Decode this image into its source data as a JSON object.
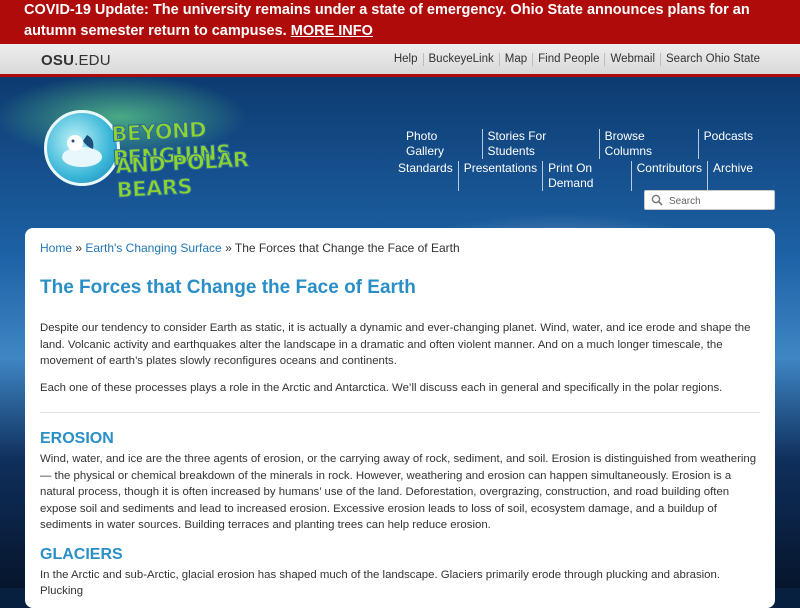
{
  "banner": {
    "text": "COVID-19 Update: The university remains under a state of emergency. Ohio State announces plans for an autumn semester return to campuses.",
    "link": "MORE INFO",
    "color": "#b00b0b"
  },
  "osu_bar": {
    "brand_bold": "OSU",
    "brand_rest": ".EDU",
    "links": [
      "Help",
      "BuckeyeLink",
      "Map",
      "Find People",
      "Webmail",
      "Search Ohio State"
    ]
  },
  "logo": {
    "line1": "BEYOND PENGUINS",
    "line2": "AND POLAR BEARS"
  },
  "nav": {
    "row1": [
      "Photo Gallery",
      "Stories For Students",
      "Browse Columns",
      "Podcasts"
    ],
    "row2": [
      "Standards",
      "Presentations",
      "Print On Demand",
      "Contributors",
      "Archive"
    ]
  },
  "search": {
    "placeholder": "Search",
    "icon": "search-icon"
  },
  "breadcrumb": {
    "home": "Home",
    "sep1": " » ",
    "parent": "Earth's Changing Surface",
    "sep2": " » ",
    "current": "The Forces that Change the Face of Earth"
  },
  "page": {
    "title": "The Forces that Change the Face of Earth",
    "intro1": "Despite our tendency to consider Earth as static, it is actually a dynamic and ever-changing planet. Wind, water, and ice erode and shape the land. Volcanic activity and earthquakes alter the landscape in a dramatic and often violent manner. And on a much longer timescale, the movement of earth’s plates slowly reconfigures oceans and continents.",
    "intro2": "Each one of these processes plays a role in the Arctic and Antarctica. We’ll discuss each in general and specifically in the polar regions.",
    "erosion_heading": "EROSION",
    "erosion_text": "Wind, water, and ice are the three agents of erosion, or the carrying away of rock, sediment, and soil. Erosion is distinguished from weathering — the physical or chemical breakdown of the minerals in rock. However, weathering and erosion can happen simultaneously. Erosion is a natural process, though it is often increased by humans’ use of the land. Deforestation, overgrazing, construction, and road building often expose soil and sediments and lead to increased erosion. Excessive erosion leads to loss of soil, ecosystem damage, and a buildup of sediments in water sources. Building terraces and planting trees can help reduce erosion.",
    "glaciers_heading": "GLACIERS",
    "glaciers_text": "In the Arctic and sub-Arctic, glacial erosion has shaped much of the landscape. Glaciers primarily erode through plucking and abrasion. Plucking",
    "accent_color": "#2a8fc7"
  }
}
